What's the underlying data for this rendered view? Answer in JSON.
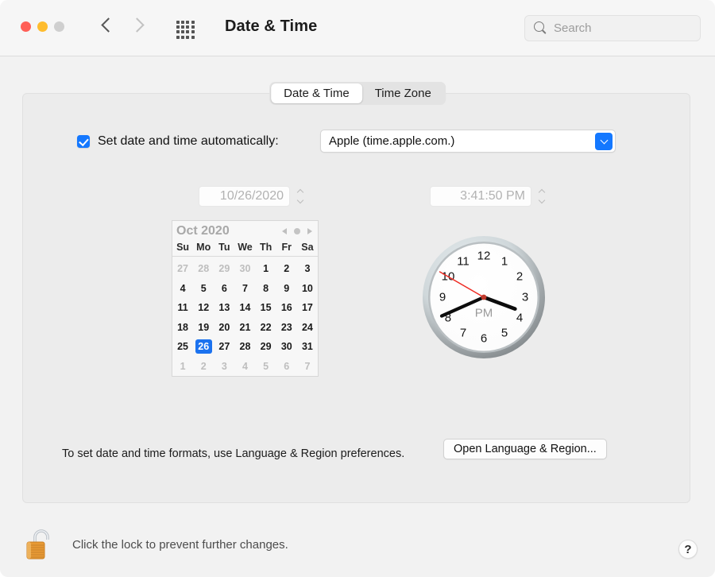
{
  "window": {
    "title": "Date & Time",
    "traffic_lights": [
      "close-red",
      "minimize-yellow",
      "zoom-gray-disabled"
    ],
    "nav": {
      "back": "back-chevron",
      "forward": "forward-chevron"
    },
    "grid_icon": "show-all-grid-icon"
  },
  "search": {
    "placeholder": "Search",
    "value": "",
    "icon": "search-icon"
  },
  "tabs": [
    {
      "label": "Date & Time",
      "active": true
    },
    {
      "label": "Time Zone",
      "active": false
    }
  ],
  "auto_setting": {
    "checked": true,
    "label": "Set date and time automatically:",
    "server_value": "Apple (time.apple.com.)",
    "dropdown_icon": "chevron-down-icon",
    "accent_color": "#1478ff"
  },
  "date_field": {
    "value": "10/26/2020",
    "disabled": true,
    "stepper": "stepper-up-down"
  },
  "time_field": {
    "value": "3:41:50 PM",
    "disabled": true,
    "stepper": "stepper-up-down"
  },
  "calendar": {
    "title": "Oct 2020",
    "nav": {
      "prev": "prev-month-triangle",
      "today": "today-dot",
      "next": "next-month-triangle"
    },
    "weekdays": [
      "Su",
      "Mo",
      "Tu",
      "We",
      "Th",
      "Fr",
      "Sa"
    ],
    "weeks": [
      [
        {
          "d": "27",
          "out": true
        },
        {
          "d": "28",
          "out": true
        },
        {
          "d": "29",
          "out": true
        },
        {
          "d": "30",
          "out": true
        },
        {
          "d": "1",
          "out": false
        },
        {
          "d": "2",
          "out": false
        },
        {
          "d": "3",
          "out": false
        }
      ],
      [
        {
          "d": "4"
        },
        {
          "d": "5"
        },
        {
          "d": "6"
        },
        {
          "d": "7"
        },
        {
          "d": "8"
        },
        {
          "d": "9"
        },
        {
          "d": "10"
        }
      ],
      [
        {
          "d": "11"
        },
        {
          "d": "12"
        },
        {
          "d": "13"
        },
        {
          "d": "14"
        },
        {
          "d": "15"
        },
        {
          "d": "16"
        },
        {
          "d": "17"
        }
      ],
      [
        {
          "d": "18"
        },
        {
          "d": "19"
        },
        {
          "d": "20"
        },
        {
          "d": "21"
        },
        {
          "d": "22"
        },
        {
          "d": "23"
        },
        {
          "d": "24"
        }
      ],
      [
        {
          "d": "25"
        },
        {
          "d": "26",
          "selected": true
        },
        {
          "d": "27"
        },
        {
          "d": "28"
        },
        {
          "d": "29"
        },
        {
          "d": "30"
        },
        {
          "d": "31"
        }
      ],
      [
        {
          "d": "1",
          "out": true
        },
        {
          "d": "2",
          "out": true
        },
        {
          "d": "3",
          "out": true
        },
        {
          "d": "4",
          "out": true
        },
        {
          "d": "5",
          "out": true
        },
        {
          "d": "6",
          "out": true
        },
        {
          "d": "7",
          "out": true
        }
      ]
    ],
    "selected_day": "26",
    "selected_color": "#1b72ef"
  },
  "clock": {
    "meridiem": "PM",
    "hour_numbers": [
      "12",
      "1",
      "2",
      "3",
      "4",
      "5",
      "6",
      "7",
      "8",
      "9",
      "10",
      "11"
    ],
    "hour_hand_deg": 110.5,
    "minute_hand_deg": 246,
    "second_hand_deg": 300,
    "second_hand_color": "#ee2a22",
    "bezel_color": "#8e9396",
    "face_color": "#fefefe"
  },
  "footer": {
    "note": "To set date and time formats, use Language & Region preferences.",
    "open_button": "Open Language & Region..."
  },
  "bottom_bar": {
    "lock_icon": "unlocked-padlock-icon",
    "lock_text": "Click the lock to prevent further changes.",
    "help_label": "?"
  }
}
